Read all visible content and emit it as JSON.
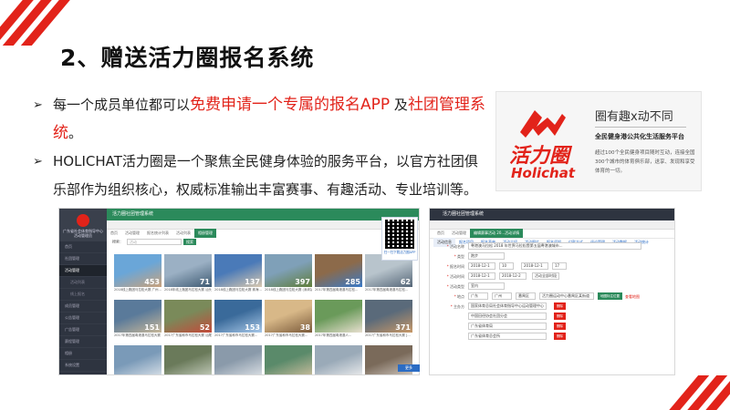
{
  "slide": {
    "title": "2、赠送活力圈报名系统",
    "bullets": [
      {
        "prefix": "每一个成员单位都可以",
        "highlight1": "免费申请一个专属的报名APP",
        "middle": " 及",
        "highlight2": "社团管理系统",
        "suffix": "。"
      },
      {
        "text": "HOLICHAT活力圈是一个聚焦全民健身体验的服务平台，以官方社团俱乐部作为组织核心，权威标准输出丰富赛事、有趣活动、专业培训等。"
      }
    ],
    "bullet_glyph": "➢",
    "accent_color": "#e2231a"
  },
  "logo_card": {
    "brand_cn": "活力圈",
    "brand_en": "Holichat",
    "slogan": "圈有趣x动不同",
    "subtitle": "全民健身港公共化生活服务平台",
    "desc": "超过100个全民健身项目随时互动，连接全国300个城市的体育俱乐部，送享、发现和享受体育的一切。"
  },
  "left_app": {
    "app_title": "活力圈社团管理系统",
    "org_name": "广东省社会体育指导中心",
    "org_sub": "活动管理员",
    "sidebar": [
      "首页",
      "社团管理",
      "活动管理",
      "活动列表",
      "线上报名",
      "成员管理",
      "公告管理",
      "广告管理",
      "赛程管理",
      "相册",
      "系统设置",
      "商城管理"
    ],
    "tabs": [
      "首页",
      "活动管理",
      "报名统计列表",
      "活动列表",
      "相册管理"
    ],
    "search_label": "搜索：",
    "search_placeholder": "活动",
    "search_button": "搜索",
    "photos": [
      {
        "num": "453",
        "cap": "2018线上跑团马拉松大赛 广州..."
      },
      {
        "num": "71",
        "cap": "2018年线上跑团马拉松大赛 汕头..."
      },
      {
        "num": "137",
        "cap": "2018线上跑团马拉松大赛 珠海..."
      },
      {
        "num": "397",
        "cap": "2018线上跑团马拉松大赛 (深圳站)"
      },
      {
        "num": "285",
        "cap": "2017年第四届粤港澳马拉松..."
      },
      {
        "num": "62",
        "cap": "2017年第四届粤港澳马拉松..."
      },
      {
        "num": "151",
        "cap": "2017年第四届粤港澳马拉松大赛 [..."
      },
      {
        "num": "52",
        "cap": "2017广东省和市马拉松大赛 汕尾..."
      },
      {
        "num": "153",
        "cap": "2017广东省和市马拉松大赛..."
      },
      {
        "num": "38",
        "cap": "2017广东省和市马拉松大赛..."
      },
      {
        "num": "",
        "cap": "2017年第四届粤港澳人..."
      },
      {
        "num": "371",
        "cap": "2017广东省和市马拉松大赛 [..."
      },
      {
        "num": "",
        "cap": ""
      },
      {
        "num": "",
        "cap": ""
      },
      {
        "num": "",
        "cap": ""
      },
      {
        "num": "",
        "cap": ""
      },
      {
        "num": "",
        "cap": ""
      },
      {
        "num": "",
        "cap": ""
      }
    ],
    "qr_caption": "扫一扫下载活力圈APP",
    "qr_button": "更多"
  },
  "right_app": {
    "app_title": "活力圈社团管理系统",
    "tabs": [
      "首页",
      "活动管理",
      "编辑赛事活动 20...活动详情"
    ],
    "subtabs": [
      "活动信息",
      "报名项目",
      "报名表单",
      "活动介绍",
      "活动图片",
      "报名须知",
      "付款方式",
      "评论管理",
      "活动数据",
      "活动统计"
    ],
    "form": {
      "name_label": "活动名称",
      "name_value": "粤港澳马拉松 2018 年世界马拉松暨第五届粤港澳城市...",
      "type_label": "类型",
      "type_value": "跑步",
      "signup_time_label": "报名时间",
      "signup_start": "2018-12-1",
      "signup_start_h": "10",
      "signup_end": "2018-12-1",
      "signup_end_h": "17",
      "event_time_label": "活动时间",
      "event_start": "2018-12-1",
      "event_end": "2018-12-2",
      "all_day": "活动全部时段",
      "class_label": "活动类型",
      "class_value": "室内",
      "place_label": "地点",
      "province": "广东",
      "city": "广州",
      "district": "番禺区",
      "address": "活力圈运动中心番禺区某街道",
      "locate_button": "地图标注位置",
      "locate_link": "查看地图",
      "host_label": "主办方",
      "hosts": [
        "国家体育总局社会体育指导中心运动管理中心",
        "中国田径协会社团分会",
        "广东省体育局",
        "广东省体育总会所"
      ],
      "delete_button": "删除"
    }
  }
}
